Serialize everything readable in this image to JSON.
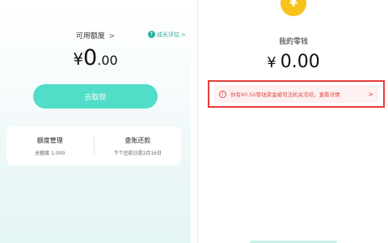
{
  "left": {
    "quota_label": "可用额度",
    "quota_chevron": ">",
    "growth_link": "成长评估",
    "growth_chevron": ">",
    "amount_symbol": "¥",
    "amount_int": "0",
    "amount_dec": ".00",
    "withdraw_button": "去取现",
    "card": {
      "quota_manage_title": "额度管理",
      "total_quota": "总额度 1,000",
      "repay_title": "查账还款",
      "next_repay": "下个还款日是2月16日"
    }
  },
  "right": {
    "coin_symbol": "¥",
    "title": "我的零钱",
    "amount_symbol": "¥",
    "amount_value": "0.00",
    "notice_text": "你有¥0.50零钱资金被司法机关冻结，查看详情",
    "notice_chevron": ">"
  },
  "colors": {
    "accent": "#51ddc7",
    "growth": "#2bb39e",
    "coin": "#f8c21b",
    "warning": "#e04848",
    "highlight_border": "#e63b3b"
  }
}
